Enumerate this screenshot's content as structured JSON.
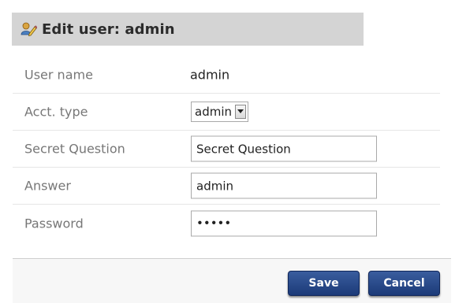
{
  "header": {
    "title": "Edit user: admin",
    "icon": "user-edit-icon"
  },
  "form": {
    "username": {
      "label": "User name",
      "value": "admin"
    },
    "acct_type": {
      "label": "Acct. type",
      "selected": "admin"
    },
    "secret_question": {
      "label": "Secret Question",
      "value": "Secret Question"
    },
    "answer": {
      "label": "Answer",
      "value": "admin"
    },
    "password": {
      "label": "Password",
      "value": "•••••"
    }
  },
  "buttons": {
    "save_label": "Save",
    "cancel_label": "Cancel"
  },
  "colors": {
    "header_bg": "#d4d4d4",
    "button_blue": "#1c3a78",
    "label_gray": "#777777"
  }
}
